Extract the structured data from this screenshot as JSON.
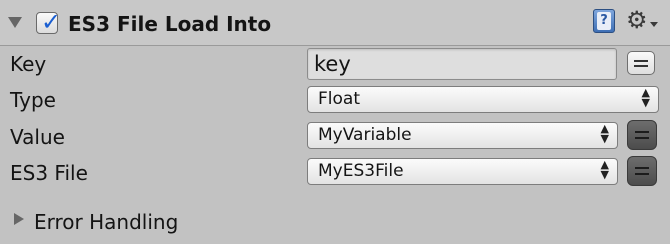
{
  "component": {
    "title": "ES3 File Load Into",
    "enabled": true,
    "help_icon": "help-book-icon",
    "settings_icon": "gear-icon"
  },
  "fields": {
    "key": {
      "label": "Key",
      "value": "key"
    },
    "type": {
      "label": "Type",
      "value": "Float"
    },
    "value": {
      "label": "Value",
      "value": "MyVariable"
    },
    "es3_file": {
      "label": "ES3 File",
      "value": "MyES3File"
    }
  },
  "error_handling": {
    "label": "Error Handling"
  },
  "colors": {
    "panel_bg": "#c2c2c2",
    "checkbox_accent": "#1b5fd1",
    "help_icon_blue": "#3e6fb5"
  }
}
